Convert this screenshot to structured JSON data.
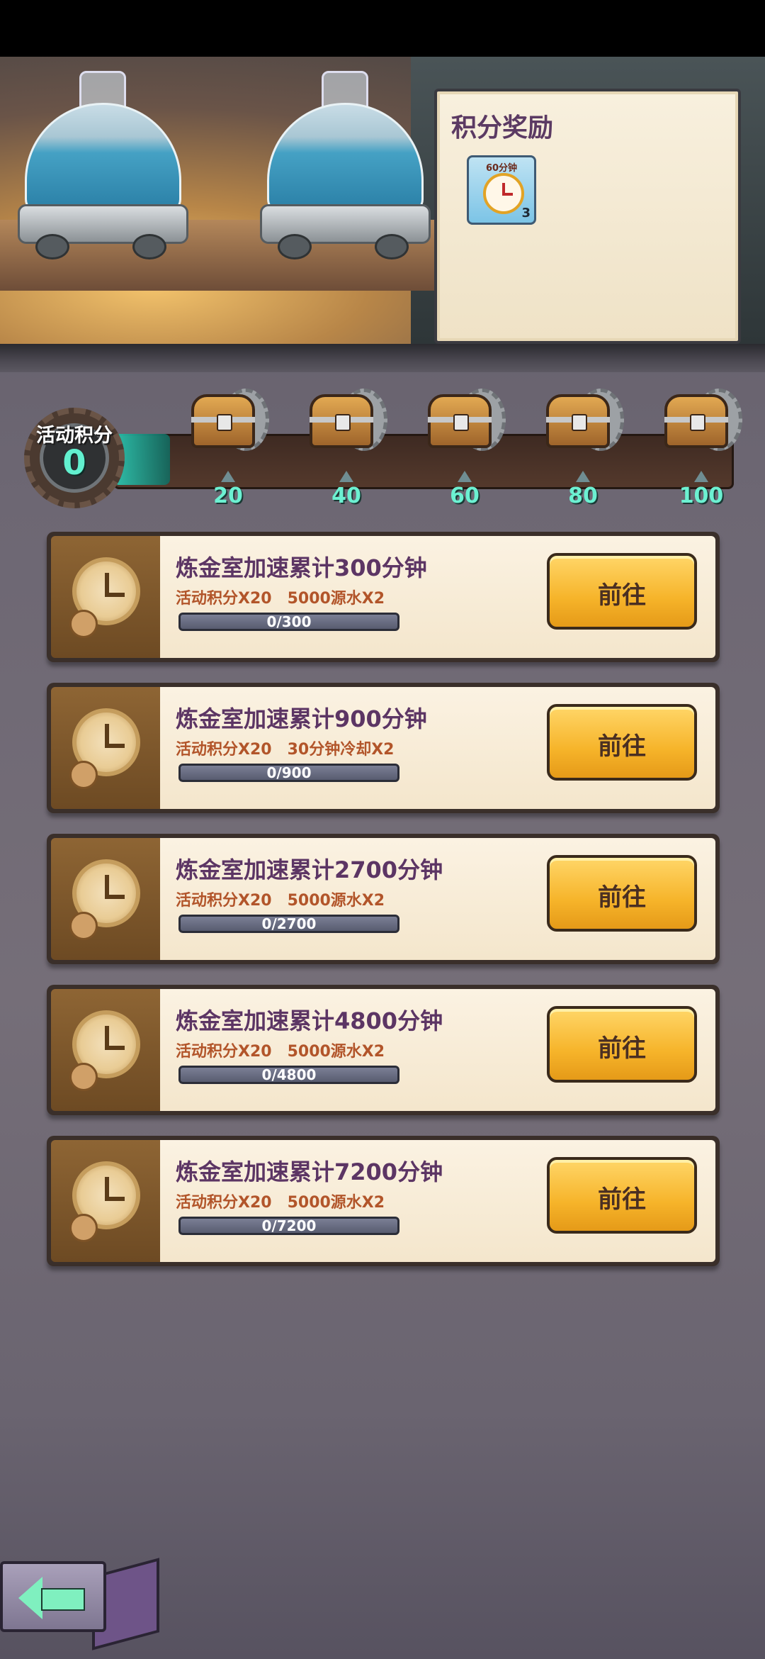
{
  "header": {
    "reward_title": "积分奖励",
    "reward_item": {
      "label": "60分钟",
      "count": "3",
      "icon": "clock-icon"
    }
  },
  "progress": {
    "label": "活动积分",
    "score": "0",
    "milestones": [
      "20",
      "40",
      "60",
      "80",
      "100"
    ]
  },
  "tasks": [
    {
      "title": "炼金室加速累计300分钟",
      "reward1": "活动积分X20",
      "reward2": "5000源水X2",
      "progress": "0/300",
      "button": "前往"
    },
    {
      "title": "炼金室加速累计900分钟",
      "reward1": "活动积分X20",
      "reward2": "30分钟冷却X2",
      "progress": "0/900",
      "button": "前往"
    },
    {
      "title": "炼金室加速累计2700分钟",
      "reward1": "活动积分X20",
      "reward2": "5000源水X2",
      "progress": "0/2700",
      "button": "前往"
    },
    {
      "title": "炼金室加速累计4800分钟",
      "reward1": "活动积分X20",
      "reward2": "5000源水X2",
      "progress": "0/4800",
      "button": "前往"
    },
    {
      "title": "炼金室加速累计7200分钟",
      "reward1": "活动积分X20",
      "reward2": "5000源水X2",
      "progress": "0/7200",
      "button": "前往"
    }
  ],
  "icons": {
    "back": "back-arrow-icon",
    "chest": "treasure-chest-icon",
    "task": "clock-icon"
  }
}
